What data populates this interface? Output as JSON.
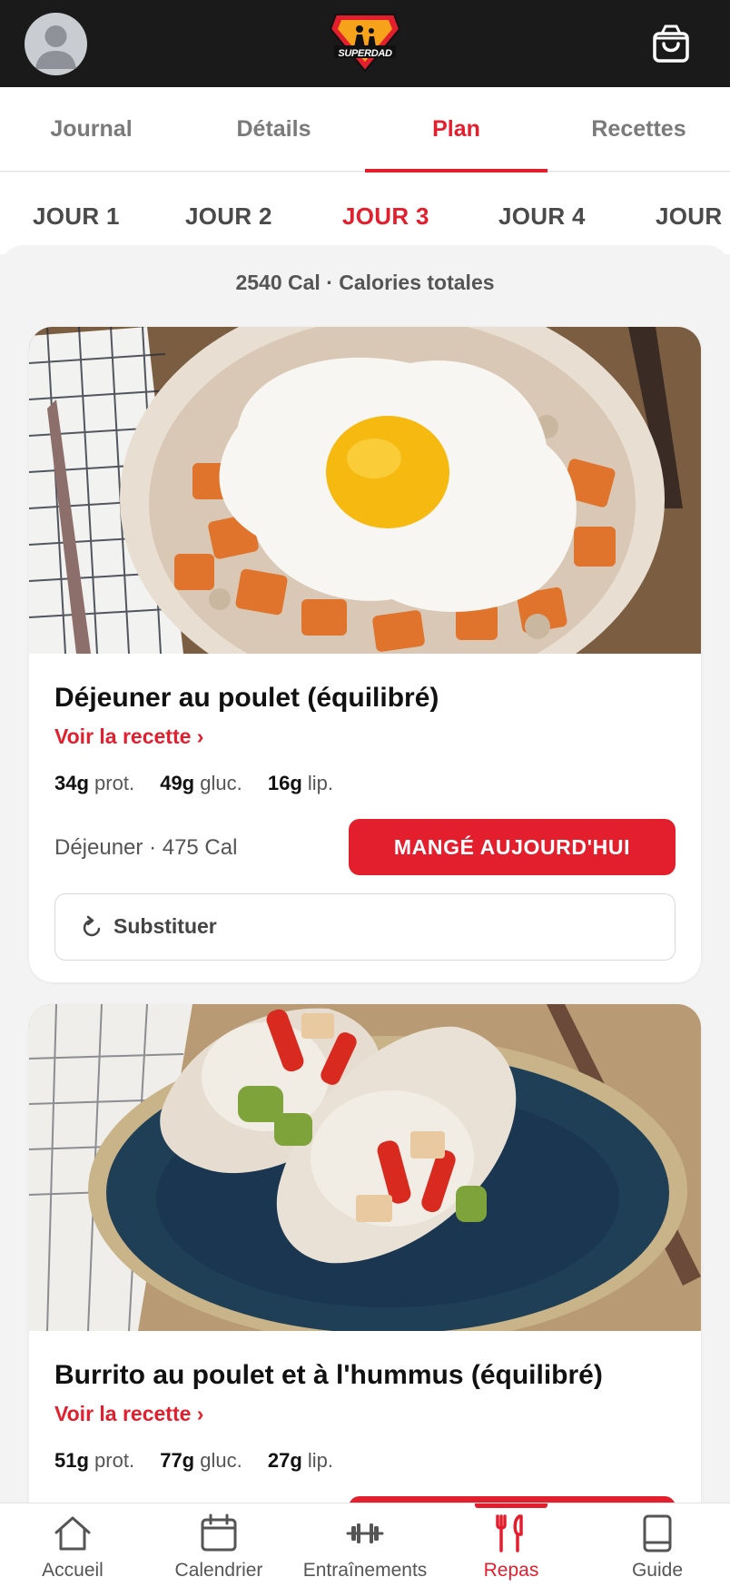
{
  "app": {
    "logo_text": "SUPERDAD"
  },
  "main_tabs": [
    {
      "label": "Journal",
      "active": false
    },
    {
      "label": "Détails",
      "active": false
    },
    {
      "label": "Plan",
      "active": true
    },
    {
      "label": "Recettes",
      "active": false
    }
  ],
  "day_tabs": [
    {
      "label": "JOUR 1",
      "active": false
    },
    {
      "label": "JOUR 2",
      "active": false
    },
    {
      "label": "JOUR 3",
      "active": true
    },
    {
      "label": "JOUR 4",
      "active": false
    },
    {
      "label": "JOUR",
      "active": false
    }
  ],
  "summary": {
    "total_calories": "2540 Cal · Calories totales"
  },
  "meals": [
    {
      "title": "Déjeuner au poulet (équilibré)",
      "recipe_link": "Voir la recette ›",
      "protein": "34g",
      "protein_unit": "prot.",
      "carbs": "49g",
      "carbs_unit": "gluc.",
      "fat": "16g",
      "fat_unit": "lip.",
      "meta": "Déjeuner · 475 Cal",
      "eaten_button": "MANGÉ AUJOURD'HUI",
      "substitute_button": "Substituer"
    },
    {
      "title": "Burrito au poulet et à l'hummus (équilibré)",
      "recipe_link": "Voir la recette ›",
      "protein": "51g",
      "protein_unit": "prot.",
      "carbs": "77g",
      "carbs_unit": "gluc.",
      "fat": "27g",
      "fat_unit": "lip."
    }
  ],
  "bottom_nav": [
    {
      "label": "Accueil",
      "icon": "home-icon",
      "active": false
    },
    {
      "label": "Calendrier",
      "icon": "calendar-icon",
      "active": false
    },
    {
      "label": "Entraînements",
      "icon": "dumbbell-icon",
      "active": false
    },
    {
      "label": "Repas",
      "icon": "utensils-icon",
      "active": true
    },
    {
      "label": "Guide",
      "icon": "book-icon",
      "active": false
    }
  ],
  "colors": {
    "accent": "#e31e2d",
    "topbar": "#1a1a1a"
  }
}
